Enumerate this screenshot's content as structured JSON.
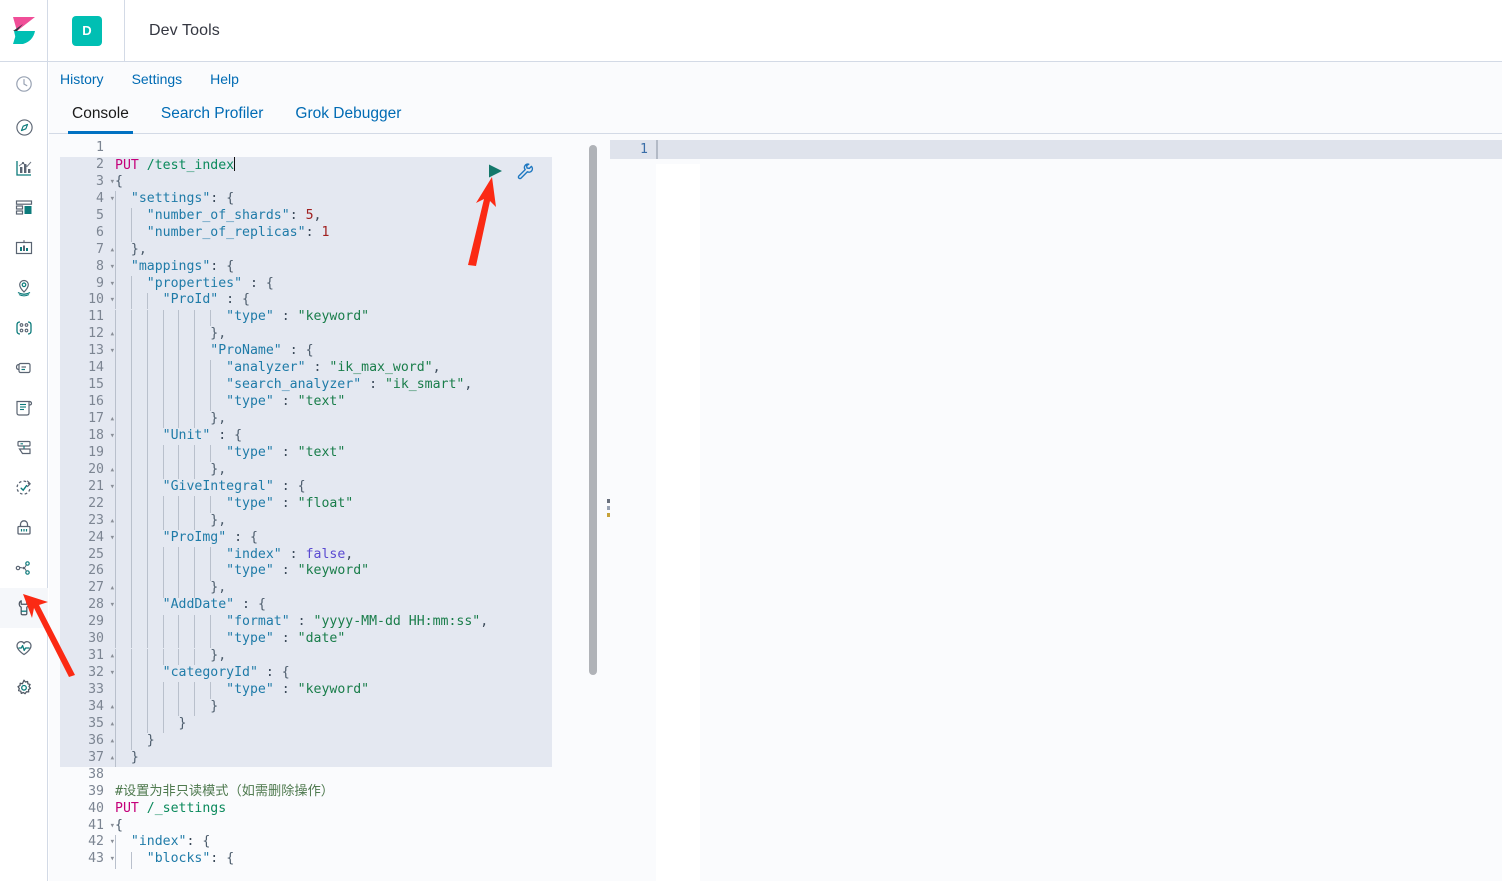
{
  "header": {
    "logo_icon": "kibana-logo",
    "app_badge": "D",
    "title": "Dev Tools"
  },
  "sidebar": {
    "items": [
      {
        "name": "recently-viewed",
        "icon": "clock-icon",
        "active": false
      },
      {
        "name": "discover",
        "icon": "compass-icon",
        "active": false
      },
      {
        "name": "visualize",
        "icon": "bar-chart-icon",
        "active": false
      },
      {
        "name": "dashboard",
        "icon": "dashboard-icon",
        "active": false
      },
      {
        "name": "canvas",
        "icon": "presentation-icon",
        "active": false
      },
      {
        "name": "maps",
        "icon": "map-marker-icon",
        "active": false
      },
      {
        "name": "machine-learning",
        "icon": "ml-nodes-icon",
        "active": false
      },
      {
        "name": "infrastructure",
        "icon": "infra-icon",
        "active": false
      },
      {
        "name": "logs",
        "icon": "logs-scroll-icon",
        "active": false
      },
      {
        "name": "apm",
        "icon": "apm-icon",
        "active": false
      },
      {
        "name": "uptime",
        "icon": "uptime-clock-icon",
        "active": false
      },
      {
        "name": "siem",
        "icon": "lock-icon",
        "active": false
      },
      {
        "name": "graph",
        "icon": "graph-nodes-icon",
        "active": false
      },
      {
        "name": "dev-tools",
        "icon": "wrench-icon",
        "active": true
      },
      {
        "name": "monitoring",
        "icon": "heart-pulse-icon",
        "active": false
      },
      {
        "name": "management",
        "icon": "gear-icon",
        "active": false
      }
    ]
  },
  "menubar": {
    "items": [
      "History",
      "Settings",
      "Help"
    ]
  },
  "tabs": [
    {
      "label": "Console",
      "active": true
    },
    {
      "label": "Search Profiler",
      "active": false
    },
    {
      "label": "Grok Debugger",
      "active": false
    }
  ],
  "editor": {
    "actions": {
      "play": "play-icon",
      "wrench": "wrench-icon"
    },
    "cursor_line": 2,
    "lines": [
      {
        "n": 1,
        "fold": "",
        "hl": false,
        "indent": 0,
        "tokens": []
      },
      {
        "n": 2,
        "fold": "",
        "hl": true,
        "indent": 0,
        "tokens": [
          {
            "t": "method",
            "v": "PUT"
          },
          {
            "t": "plain",
            "v": " "
          },
          {
            "t": "url",
            "v": "/test_index"
          },
          {
            "t": "caret",
            "v": ""
          }
        ]
      },
      {
        "n": 3,
        "fold": "▾",
        "hl": true,
        "indent": 0,
        "tokens": [
          {
            "t": "brace",
            "v": "{"
          }
        ]
      },
      {
        "n": 4,
        "fold": "▾",
        "hl": true,
        "indent": 1,
        "tokens": [
          {
            "t": "key",
            "v": "\"settings\""
          },
          {
            "t": "punct",
            "v": ": "
          },
          {
            "t": "brace",
            "v": "{"
          }
        ]
      },
      {
        "n": 5,
        "fold": "",
        "hl": true,
        "indent": 2,
        "tokens": [
          {
            "t": "key",
            "v": "\"number_of_shards\""
          },
          {
            "t": "punct",
            "v": ": "
          },
          {
            "t": "num",
            "v": "5"
          },
          {
            "t": "punct",
            "v": ","
          }
        ]
      },
      {
        "n": 6,
        "fold": "",
        "hl": true,
        "indent": 2,
        "tokens": [
          {
            "t": "key",
            "v": "\"number_of_replicas\""
          },
          {
            "t": "punct",
            "v": ": "
          },
          {
            "t": "num",
            "v": "1"
          }
        ]
      },
      {
        "n": 7,
        "fold": "▴",
        "hl": true,
        "indent": 1,
        "tokens": [
          {
            "t": "brace",
            "v": "},"
          }
        ]
      },
      {
        "n": 8,
        "fold": "▾",
        "hl": true,
        "indent": 1,
        "tokens": [
          {
            "t": "key",
            "v": "\"mappings\""
          },
          {
            "t": "punct",
            "v": ": "
          },
          {
            "t": "brace",
            "v": "{"
          }
        ]
      },
      {
        "n": 9,
        "fold": "▾",
        "hl": true,
        "indent": 2,
        "tokens": [
          {
            "t": "key",
            "v": "\"properties\""
          },
          {
            "t": "punct",
            "v": " : "
          },
          {
            "t": "brace",
            "v": "{"
          }
        ]
      },
      {
        "n": 10,
        "fold": "▾",
        "hl": true,
        "indent": 3,
        "tokens": [
          {
            "t": "key",
            "v": "\"ProId\""
          },
          {
            "t": "punct",
            "v": " : "
          },
          {
            "t": "brace",
            "v": "{"
          }
        ]
      },
      {
        "n": 11,
        "fold": "",
        "hl": true,
        "indent": 7,
        "tokens": [
          {
            "t": "key",
            "v": "\"type\""
          },
          {
            "t": "punct",
            "v": " : "
          },
          {
            "t": "str",
            "v": "\"keyword\""
          }
        ]
      },
      {
        "n": 12,
        "fold": "▴",
        "hl": true,
        "indent": 6,
        "tokens": [
          {
            "t": "brace",
            "v": "},"
          }
        ]
      },
      {
        "n": 13,
        "fold": "▾",
        "hl": true,
        "indent": 6,
        "tokens": [
          {
            "t": "key",
            "v": "\"ProName\""
          },
          {
            "t": "punct",
            "v": " : "
          },
          {
            "t": "brace",
            "v": "{"
          }
        ]
      },
      {
        "n": 14,
        "fold": "",
        "hl": true,
        "indent": 7,
        "tokens": [
          {
            "t": "key",
            "v": "\"analyzer\""
          },
          {
            "t": "punct",
            "v": " : "
          },
          {
            "t": "str",
            "v": "\"ik_max_word\""
          },
          {
            "t": "punct",
            "v": ","
          }
        ]
      },
      {
        "n": 15,
        "fold": "",
        "hl": true,
        "indent": 7,
        "tokens": [
          {
            "t": "key",
            "v": "\"search_analyzer\""
          },
          {
            "t": "punct",
            "v": " : "
          },
          {
            "t": "str",
            "v": "\"ik_smart\""
          },
          {
            "t": "punct",
            "v": ","
          }
        ]
      },
      {
        "n": 16,
        "fold": "",
        "hl": true,
        "indent": 7,
        "tokens": [
          {
            "t": "key",
            "v": "\"type\""
          },
          {
            "t": "punct",
            "v": " : "
          },
          {
            "t": "str",
            "v": "\"text\""
          }
        ]
      },
      {
        "n": 17,
        "fold": "▴",
        "hl": true,
        "indent": 6,
        "tokens": [
          {
            "t": "brace",
            "v": "},"
          }
        ]
      },
      {
        "n": 18,
        "fold": "▾",
        "hl": true,
        "indent": 3,
        "tokens": [
          {
            "t": "key",
            "v": "\"Unit\""
          },
          {
            "t": "punct",
            "v": " : "
          },
          {
            "t": "brace",
            "v": "{"
          }
        ]
      },
      {
        "n": 19,
        "fold": "",
        "hl": true,
        "indent": 7,
        "tokens": [
          {
            "t": "key",
            "v": "\"type\""
          },
          {
            "t": "punct",
            "v": " : "
          },
          {
            "t": "str",
            "v": "\"text\""
          }
        ]
      },
      {
        "n": 20,
        "fold": "▴",
        "hl": true,
        "indent": 6,
        "tokens": [
          {
            "t": "brace",
            "v": "},"
          }
        ]
      },
      {
        "n": 21,
        "fold": "▾",
        "hl": true,
        "indent": 3,
        "tokens": [
          {
            "t": "key",
            "v": "\"GiveIntegral\""
          },
          {
            "t": "punct",
            "v": " : "
          },
          {
            "t": "brace",
            "v": "{"
          }
        ]
      },
      {
        "n": 22,
        "fold": "",
        "hl": true,
        "indent": 7,
        "tokens": [
          {
            "t": "key",
            "v": "\"type\""
          },
          {
            "t": "punct",
            "v": " : "
          },
          {
            "t": "str",
            "v": "\"float\""
          }
        ]
      },
      {
        "n": 23,
        "fold": "▴",
        "hl": true,
        "indent": 6,
        "tokens": [
          {
            "t": "brace",
            "v": "},"
          }
        ]
      },
      {
        "n": 24,
        "fold": "▾",
        "hl": true,
        "indent": 3,
        "tokens": [
          {
            "t": "key",
            "v": "\"ProImg\""
          },
          {
            "t": "punct",
            "v": " : "
          },
          {
            "t": "brace",
            "v": "{"
          }
        ]
      },
      {
        "n": 25,
        "fold": "",
        "hl": true,
        "indent": 7,
        "tokens": [
          {
            "t": "key",
            "v": "\"index\""
          },
          {
            "t": "punct",
            "v": " : "
          },
          {
            "t": "bool",
            "v": "false"
          },
          {
            "t": "punct",
            "v": ","
          }
        ]
      },
      {
        "n": 26,
        "fold": "",
        "hl": true,
        "indent": 7,
        "tokens": [
          {
            "t": "key",
            "v": "\"type\""
          },
          {
            "t": "punct",
            "v": " : "
          },
          {
            "t": "str",
            "v": "\"keyword\""
          }
        ]
      },
      {
        "n": 27,
        "fold": "▴",
        "hl": true,
        "indent": 6,
        "tokens": [
          {
            "t": "brace",
            "v": "},"
          }
        ]
      },
      {
        "n": 28,
        "fold": "▾",
        "hl": true,
        "indent": 3,
        "tokens": [
          {
            "t": "key",
            "v": "\"AddDate\""
          },
          {
            "t": "punct",
            "v": " : "
          },
          {
            "t": "brace",
            "v": "{"
          }
        ]
      },
      {
        "n": 29,
        "fold": "",
        "hl": true,
        "indent": 7,
        "tokens": [
          {
            "t": "key",
            "v": "\"format\""
          },
          {
            "t": "punct",
            "v": " : "
          },
          {
            "t": "str",
            "v": "\"yyyy-MM-dd HH:mm:ss\""
          },
          {
            "t": "punct",
            "v": ","
          }
        ]
      },
      {
        "n": 30,
        "fold": "",
        "hl": true,
        "indent": 7,
        "tokens": [
          {
            "t": "key",
            "v": "\"type\""
          },
          {
            "t": "punct",
            "v": " : "
          },
          {
            "t": "str",
            "v": "\"date\""
          }
        ]
      },
      {
        "n": 31,
        "fold": "▴",
        "hl": true,
        "indent": 6,
        "tokens": [
          {
            "t": "brace",
            "v": "},"
          }
        ]
      },
      {
        "n": 32,
        "fold": "▾",
        "hl": true,
        "indent": 3,
        "tokens": [
          {
            "t": "key",
            "v": "\"categoryId\""
          },
          {
            "t": "punct",
            "v": " : "
          },
          {
            "t": "brace",
            "v": "{"
          }
        ]
      },
      {
        "n": 33,
        "fold": "",
        "hl": true,
        "indent": 7,
        "tokens": [
          {
            "t": "key",
            "v": "\"type\""
          },
          {
            "t": "punct",
            "v": " : "
          },
          {
            "t": "str",
            "v": "\"keyword\""
          }
        ]
      },
      {
        "n": 34,
        "fold": "▴",
        "hl": true,
        "indent": 6,
        "tokens": [
          {
            "t": "brace",
            "v": "}"
          }
        ]
      },
      {
        "n": 35,
        "fold": "▴",
        "hl": true,
        "indent": 4,
        "tokens": [
          {
            "t": "brace",
            "v": "}"
          }
        ]
      },
      {
        "n": 36,
        "fold": "▴",
        "hl": true,
        "indent": 2,
        "tokens": [
          {
            "t": "brace",
            "v": "}"
          }
        ]
      },
      {
        "n": 37,
        "fold": "▴",
        "hl": true,
        "indent": 1,
        "tokens": [
          {
            "t": "brace",
            "v": "}"
          }
        ]
      },
      {
        "n": 38,
        "fold": "",
        "hl": false,
        "indent": 0,
        "tokens": []
      },
      {
        "n": 39,
        "fold": "",
        "hl": false,
        "indent": 0,
        "tokens": [
          {
            "t": "comment",
            "v": "#设置为非只读模式（如需删除操作）"
          }
        ]
      },
      {
        "n": 40,
        "fold": "",
        "hl": false,
        "indent": 0,
        "tokens": [
          {
            "t": "method",
            "v": "PUT"
          },
          {
            "t": "plain",
            "v": " "
          },
          {
            "t": "url",
            "v": "/_settings"
          }
        ]
      },
      {
        "n": 41,
        "fold": "▾",
        "hl": false,
        "indent": 0,
        "tokens": [
          {
            "t": "brace",
            "v": "{"
          }
        ]
      },
      {
        "n": 42,
        "fold": "▾",
        "hl": false,
        "indent": 1,
        "tokens": [
          {
            "t": "key",
            "v": "\"index\""
          },
          {
            "t": "punct",
            "v": ": "
          },
          {
            "t": "brace",
            "v": "{"
          }
        ]
      },
      {
        "n": 43,
        "fold": "▾",
        "hl": false,
        "indent": 2,
        "tokens": [
          {
            "t": "key",
            "v": "\"blocks\""
          },
          {
            "t": "punct",
            "v": ": "
          },
          {
            "t": "brace",
            "v": "{"
          }
        ]
      }
    ]
  },
  "output": {
    "line_number": "1",
    "body": ""
  },
  "annotations": {
    "arrow_color": "#fb2a14",
    "arrows": [
      {
        "name": "arrow-to-play-button"
      },
      {
        "name": "arrow-to-dev-tools-sidebar-icon"
      }
    ]
  },
  "colors": {
    "accent": "#006bb4",
    "brand_teal": "#00bfb3",
    "brand_pink": "#f04e98",
    "tab_underline": "#0071c2",
    "editor_highlight": "#e4e8f1"
  }
}
